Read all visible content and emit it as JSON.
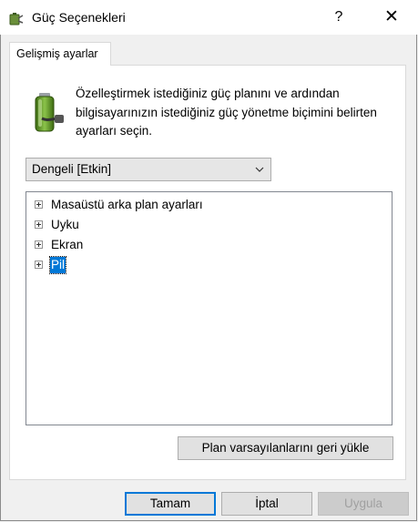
{
  "window": {
    "title": "Güç Seçenekleri",
    "help": "?",
    "close": "✕"
  },
  "tabs": [
    {
      "label": "Gelişmiş ayarlar",
      "active": true
    }
  ],
  "description": "Özelleştirmek istediğiniz güç planını ve ardından bilgisayarınızın istediğiniz güç yönetme biçimini belirten ayarları seçin.",
  "plan_select": {
    "value": "Dengeli [Etkin]"
  },
  "tree": {
    "items": [
      {
        "label": "Masaüstü arka plan ayarları",
        "selected": false
      },
      {
        "label": "Uyku",
        "selected": false
      },
      {
        "label": "Ekran",
        "selected": false
      },
      {
        "label": "Pil",
        "selected": true
      }
    ]
  },
  "buttons": {
    "restore": "Plan varsayılanlarını geri yükle",
    "ok": "Tamam",
    "apply": "İptal",
    "cancel": "Uygula"
  },
  "colors": {
    "accent": "#0078d7",
    "window_bg": "#f0f0f0"
  }
}
